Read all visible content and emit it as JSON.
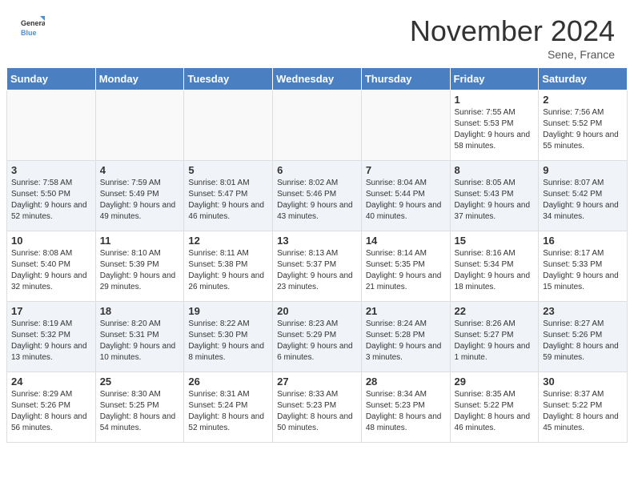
{
  "header": {
    "logo_general": "General",
    "logo_blue": "Blue",
    "month_title": "November 2024",
    "location": "Sene, France"
  },
  "calendar": {
    "days_of_week": [
      "Sunday",
      "Monday",
      "Tuesday",
      "Wednesday",
      "Thursday",
      "Friday",
      "Saturday"
    ],
    "weeks": [
      {
        "shaded": false,
        "days": [
          {
            "date": "",
            "info": ""
          },
          {
            "date": "",
            "info": ""
          },
          {
            "date": "",
            "info": ""
          },
          {
            "date": "",
            "info": ""
          },
          {
            "date": "",
            "info": ""
          },
          {
            "date": "1",
            "info": "Sunrise: 7:55 AM\nSunset: 5:53 PM\nDaylight: 9 hours and 58 minutes."
          },
          {
            "date": "2",
            "info": "Sunrise: 7:56 AM\nSunset: 5:52 PM\nDaylight: 9 hours and 55 minutes."
          }
        ]
      },
      {
        "shaded": true,
        "days": [
          {
            "date": "3",
            "info": "Sunrise: 7:58 AM\nSunset: 5:50 PM\nDaylight: 9 hours and 52 minutes."
          },
          {
            "date": "4",
            "info": "Sunrise: 7:59 AM\nSunset: 5:49 PM\nDaylight: 9 hours and 49 minutes."
          },
          {
            "date": "5",
            "info": "Sunrise: 8:01 AM\nSunset: 5:47 PM\nDaylight: 9 hours and 46 minutes."
          },
          {
            "date": "6",
            "info": "Sunrise: 8:02 AM\nSunset: 5:46 PM\nDaylight: 9 hours and 43 minutes."
          },
          {
            "date": "7",
            "info": "Sunrise: 8:04 AM\nSunset: 5:44 PM\nDaylight: 9 hours and 40 minutes."
          },
          {
            "date": "8",
            "info": "Sunrise: 8:05 AM\nSunset: 5:43 PM\nDaylight: 9 hours and 37 minutes."
          },
          {
            "date": "9",
            "info": "Sunrise: 8:07 AM\nSunset: 5:42 PM\nDaylight: 9 hours and 34 minutes."
          }
        ]
      },
      {
        "shaded": false,
        "days": [
          {
            "date": "10",
            "info": "Sunrise: 8:08 AM\nSunset: 5:40 PM\nDaylight: 9 hours and 32 minutes."
          },
          {
            "date": "11",
            "info": "Sunrise: 8:10 AM\nSunset: 5:39 PM\nDaylight: 9 hours and 29 minutes."
          },
          {
            "date": "12",
            "info": "Sunrise: 8:11 AM\nSunset: 5:38 PM\nDaylight: 9 hours and 26 minutes."
          },
          {
            "date": "13",
            "info": "Sunrise: 8:13 AM\nSunset: 5:37 PM\nDaylight: 9 hours and 23 minutes."
          },
          {
            "date": "14",
            "info": "Sunrise: 8:14 AM\nSunset: 5:35 PM\nDaylight: 9 hours and 21 minutes."
          },
          {
            "date": "15",
            "info": "Sunrise: 8:16 AM\nSunset: 5:34 PM\nDaylight: 9 hours and 18 minutes."
          },
          {
            "date": "16",
            "info": "Sunrise: 8:17 AM\nSunset: 5:33 PM\nDaylight: 9 hours and 15 minutes."
          }
        ]
      },
      {
        "shaded": true,
        "days": [
          {
            "date": "17",
            "info": "Sunrise: 8:19 AM\nSunset: 5:32 PM\nDaylight: 9 hours and 13 minutes."
          },
          {
            "date": "18",
            "info": "Sunrise: 8:20 AM\nSunset: 5:31 PM\nDaylight: 9 hours and 10 minutes."
          },
          {
            "date": "19",
            "info": "Sunrise: 8:22 AM\nSunset: 5:30 PM\nDaylight: 9 hours and 8 minutes."
          },
          {
            "date": "20",
            "info": "Sunrise: 8:23 AM\nSunset: 5:29 PM\nDaylight: 9 hours and 6 minutes."
          },
          {
            "date": "21",
            "info": "Sunrise: 8:24 AM\nSunset: 5:28 PM\nDaylight: 9 hours and 3 minutes."
          },
          {
            "date": "22",
            "info": "Sunrise: 8:26 AM\nSunset: 5:27 PM\nDaylight: 9 hours and 1 minute."
          },
          {
            "date": "23",
            "info": "Sunrise: 8:27 AM\nSunset: 5:26 PM\nDaylight: 8 hours and 59 minutes."
          }
        ]
      },
      {
        "shaded": false,
        "days": [
          {
            "date": "24",
            "info": "Sunrise: 8:29 AM\nSunset: 5:26 PM\nDaylight: 8 hours and 56 minutes."
          },
          {
            "date": "25",
            "info": "Sunrise: 8:30 AM\nSunset: 5:25 PM\nDaylight: 8 hours and 54 minutes."
          },
          {
            "date": "26",
            "info": "Sunrise: 8:31 AM\nSunset: 5:24 PM\nDaylight: 8 hours and 52 minutes."
          },
          {
            "date": "27",
            "info": "Sunrise: 8:33 AM\nSunset: 5:23 PM\nDaylight: 8 hours and 50 minutes."
          },
          {
            "date": "28",
            "info": "Sunrise: 8:34 AM\nSunset: 5:23 PM\nDaylight: 8 hours and 48 minutes."
          },
          {
            "date": "29",
            "info": "Sunrise: 8:35 AM\nSunset: 5:22 PM\nDaylight: 8 hours and 46 minutes."
          },
          {
            "date": "30",
            "info": "Sunrise: 8:37 AM\nSunset: 5:22 PM\nDaylight: 8 hours and 45 minutes."
          }
        ]
      }
    ]
  }
}
